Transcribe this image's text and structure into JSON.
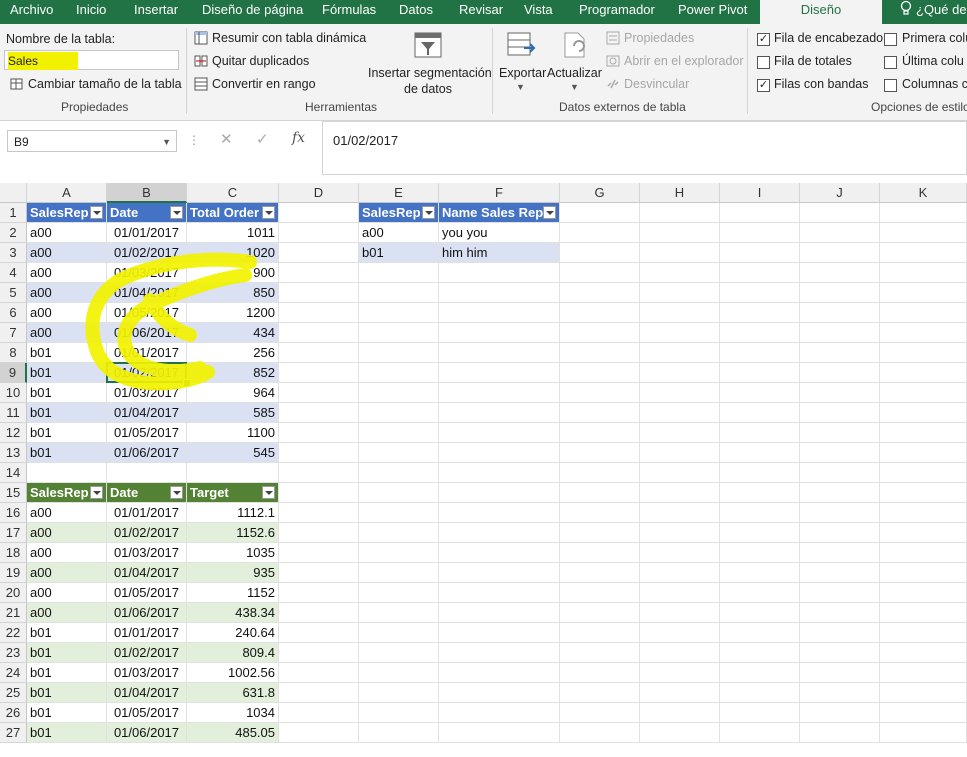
{
  "tabs": [
    "Archivo",
    "Inicio",
    "Insertar",
    "Diseño de página",
    "Fórmulas",
    "Datos",
    "Revisar",
    "Vista",
    "Programador",
    "Power Pivot",
    "Diseño",
    "¿Qué dese"
  ],
  "ribbon": {
    "table_name_label": "Nombre de la tabla:",
    "table_name_value": "Sales",
    "resize_table": "Cambiar tamaño de la tabla",
    "group_properties": "Propiedades",
    "summarize_pivot": "Resumir con tabla dinámica",
    "remove_duplicates": "Quitar duplicados",
    "convert_range": "Convertir en rango",
    "insert_slicer_1": "Insertar segmentación",
    "insert_slicer_2": "de datos",
    "group_tools": "Herramientas",
    "export": "Exportar",
    "refresh": "Actualizar",
    "properties": "Propiedades",
    "open_browser": "Abrir en el explorador",
    "unlink": "Desvincular",
    "group_external": "Datos externos de tabla",
    "header_row": "Fila de encabezado",
    "total_row": "Fila de totales",
    "banded_rows": "Filas con bandas",
    "first_column": "Primera colu",
    "last_column": "Última colu",
    "banded_columns": "Columnas c",
    "group_style_options": "Opciones de estilo",
    "header_row_checked": true,
    "total_row_checked": false,
    "banded_rows_checked": true
  },
  "formula_bar": {
    "name_box": "B9",
    "fx": "fx",
    "value": "01/02/2017"
  },
  "columns": [
    "A",
    "B",
    "C",
    "D",
    "E",
    "F",
    "G",
    "H",
    "I",
    "J",
    "K"
  ],
  "rows": [
    "1",
    "2",
    "3",
    "4",
    "5",
    "6",
    "7",
    "8",
    "9",
    "10",
    "11",
    "12",
    "13",
    "14",
    "15",
    "16",
    "17",
    "18",
    "19",
    "20",
    "21",
    "22",
    "23",
    "24",
    "25",
    "26",
    "27"
  ],
  "sales_table": {
    "headers": [
      "SalesRep",
      "Date",
      "Total Order"
    ],
    "rows": [
      [
        "a00",
        "01/01/2017",
        "1011"
      ],
      [
        "a00",
        "01/02/2017",
        "1020"
      ],
      [
        "a00",
        "01/03/2017",
        "900"
      ],
      [
        "a00",
        "01/04/2017",
        "850"
      ],
      [
        "a00",
        "01/05/2017",
        "1200"
      ],
      [
        "a00",
        "01/06/2017",
        "434"
      ],
      [
        "b01",
        "01/01/2017",
        "256"
      ],
      [
        "b01",
        "01/02/2017",
        "852"
      ],
      [
        "b01",
        "01/03/2017",
        "964"
      ],
      [
        "b01",
        "01/04/2017",
        "585"
      ],
      [
        "b01",
        "01/05/2017",
        "1100"
      ],
      [
        "b01",
        "01/06/2017",
        "545"
      ]
    ]
  },
  "target_table": {
    "headers": [
      "SalesRep",
      "Date",
      "Target"
    ],
    "rows": [
      [
        "a00",
        "01/01/2017",
        "1112.1"
      ],
      [
        "a00",
        "01/02/2017",
        "1152.6"
      ],
      [
        "a00",
        "01/03/2017",
        "1035"
      ],
      [
        "a00",
        "01/04/2017",
        "935"
      ],
      [
        "a00",
        "01/05/2017",
        "1152"
      ],
      [
        "a00",
        "01/06/2017",
        "438.34"
      ],
      [
        "b01",
        "01/01/2017",
        "240.64"
      ],
      [
        "b01",
        "01/02/2017",
        "809.4"
      ],
      [
        "b01",
        "01/03/2017",
        "1002.56"
      ],
      [
        "b01",
        "01/04/2017",
        "631.8"
      ],
      [
        "b01",
        "01/05/2017",
        "1034"
      ],
      [
        "b01",
        "01/06/2017",
        "485.05"
      ]
    ]
  },
  "rep_table": {
    "headers": [
      "SalesRep",
      "Name Sales Rep"
    ],
    "rows": [
      [
        "a00",
        "you you"
      ],
      [
        "b01",
        "him him"
      ]
    ]
  },
  "selected_cell": "B9",
  "colors": {
    "excel_green": "#217346",
    "table_blue": "#4472c4",
    "band_blue": "#d9e1f2",
    "table_green": "#548235",
    "highlight_yellow": "#f2f200"
  }
}
